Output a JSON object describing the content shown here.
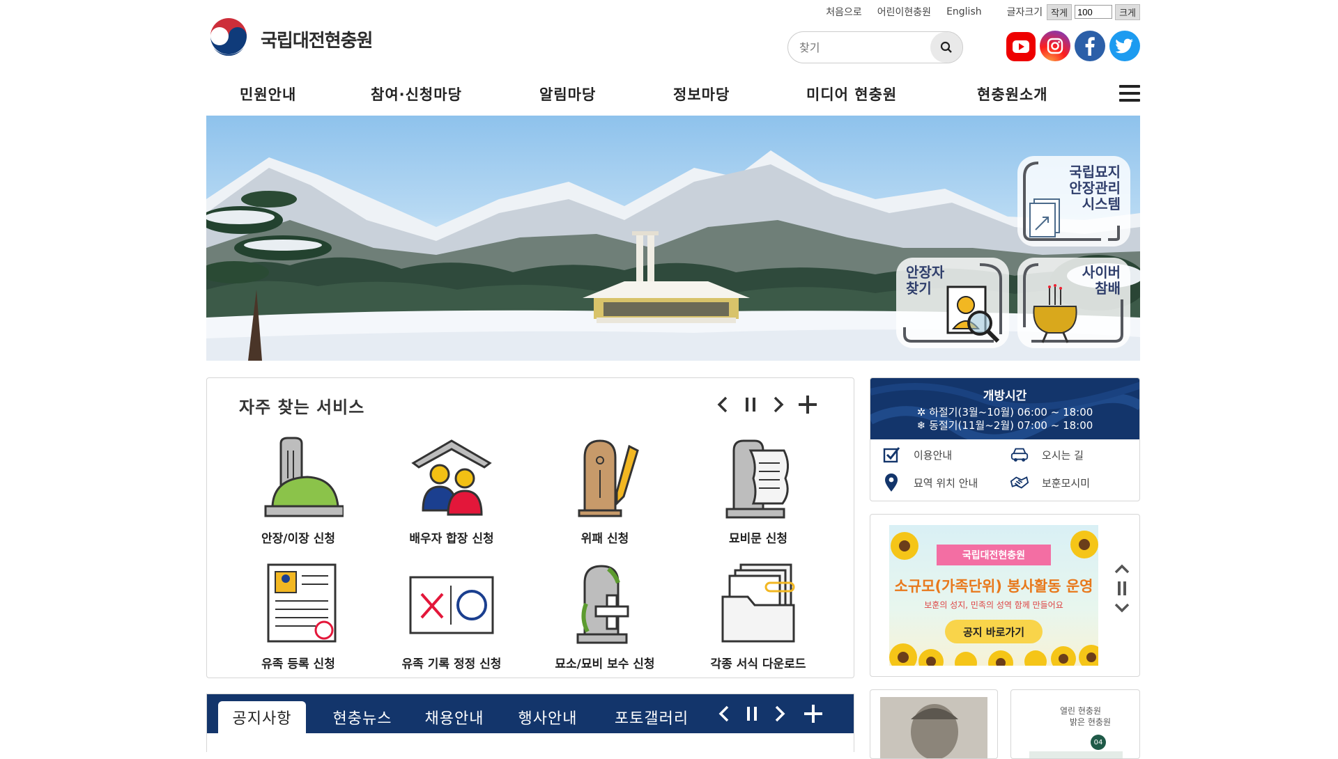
{
  "header": {
    "site_name": "국립대전현충원",
    "util_links": [
      "처음으로",
      "어린이현충원",
      "English"
    ],
    "font_size_label": "글자크기",
    "font_smaller": "작게",
    "font_value": "100",
    "font_larger": "크게",
    "search_placeholder": "찾기",
    "social": [
      "youtube-icon",
      "instagram-icon",
      "facebook-icon",
      "twitter-icon"
    ]
  },
  "nav": {
    "items": [
      "민원안내",
      "참여·신청마당",
      "알림마당",
      "정보마당",
      "미디어 현충원",
      "현충원소개"
    ]
  },
  "banner": {
    "quick_links": [
      "국립묘지 안장관리 시스템",
      "안장자 찾기",
      "사이버 참배"
    ],
    "quick_lines": {
      "system": [
        "국립묘지",
        "안장관리",
        "시스템"
      ],
      "find": [
        "안장자",
        "찾기"
      ],
      "cyber": [
        "사이버",
        "참배"
      ]
    }
  },
  "services": {
    "title": "자주 찾는 서비스",
    "items": [
      {
        "label": "안장/이장 신청",
        "icon": "tombstone-icon"
      },
      {
        "label": "배우자 합장 신청",
        "icon": "couple-icon"
      },
      {
        "label": "위패 신청",
        "icon": "memorial-tablet-icon"
      },
      {
        "label": "묘비문 신청",
        "icon": "epitaph-scroll-icon"
      },
      {
        "label": "유족 등록 신청",
        "icon": "registration-form-icon"
      },
      {
        "label": "유족 기록 정정 신청",
        "icon": "ox-correction-icon"
      },
      {
        "label": "묘소/묘비 보수 신청",
        "icon": "grave-repair-icon"
      },
      {
        "label": "각종 서식 다운로드",
        "icon": "folder-documents-icon"
      }
    ]
  },
  "hours": {
    "title": "개방시간",
    "summer": "하절기(3월~10월) 06:00 ~ 18:00",
    "winter": "동절기(11월~2월) 07:00 ~ 18:00",
    "links": [
      "이용안내",
      "오시는 길",
      "묘역 위치 안내",
      "보훈모시미"
    ]
  },
  "promo": {
    "org": "국립대전현충원",
    "headline": "소규모(가족단위) 봉사활동 운영",
    "subline": "보훈의 성지, 민족의 성역 함께 만들어요",
    "button": "공지 바로가기"
  },
  "notice": {
    "tabs": [
      "공지사항",
      "현충뉴스",
      "채용안내",
      "행사안내",
      "포토갤러리"
    ],
    "active": "공지사항"
  },
  "mini": {
    "title_line1": "열린 현충원",
    "title_line2": "밝은 현충원",
    "badge": "04"
  },
  "colors": {
    "navy": "#13356b",
    "accent_red": "#e00000",
    "text": "#222222"
  }
}
